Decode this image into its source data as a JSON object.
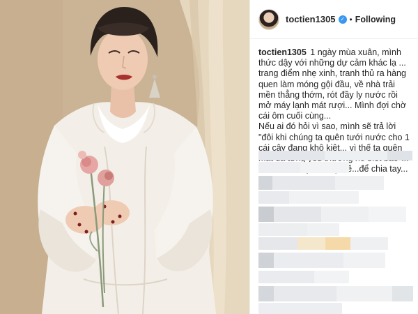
{
  "post": {
    "author": {
      "username": "toctien1305",
      "verified_icon": "verified-badge-icon",
      "verified_symbol": "✓",
      "avatar_icon": "profile-avatar"
    },
    "separator": "•",
    "follow_state": "Following",
    "caption": {
      "username": "toctien1305",
      "paragraph_1": "1 ngày mùa xuân, mình thức dậy với những dự cảm khác lạ ... trang điểm nhẹ xinh, tranh thủ ra hàng quen làm móng gội đầu, về nhà trải mền thẳng thớm, rót đầy ly nước rồi mở máy lạnh mát rượi... Mình đợi chờ cái ôm cuối cùng...",
      "paragraph_2": "Nếu ai đó hỏi vì sao, mình sẽ trả lời \"đôi khi chúng ta quên tưới nước cho 1 cái cây đang khô kiệt... vì thế ta quên mất đã từng yêu thương nó biết bao\"...",
      "paragraph_3": "Thật là một lý do đẹp đẽ...để chia tay..."
    },
    "photo": {
      "description_icon": "post-photo",
      "colors": {
        "background": "#cdb79a",
        "curtain": "#e8dcc6",
        "shirt": "#f4f1ec",
        "hair": "#2a211d",
        "skin": "#ecc8b1",
        "lips": "#a8322d",
        "flower": "#e3a3a3"
      }
    },
    "comments_area": {
      "state": "pixelated"
    }
  }
}
